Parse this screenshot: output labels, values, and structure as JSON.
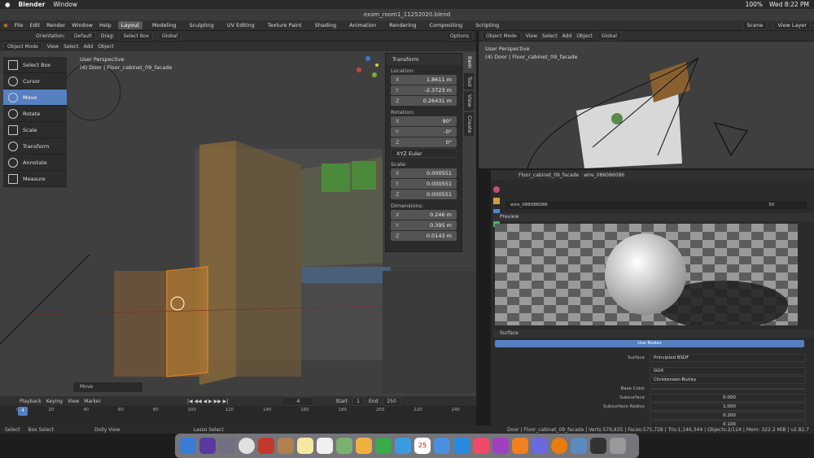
{
  "mac_menu": {
    "app": "Blender",
    "window": "Window",
    "battery": "100%",
    "clock": "Wed 8:22 PM"
  },
  "window_title": "exam_room1_11252020.blend",
  "top_menu": [
    "File",
    "Edit",
    "Render",
    "Window",
    "Help"
  ],
  "workspaces": [
    "Layout",
    "Modeling",
    "Sculpting",
    "UV Editing",
    "Texture Paint",
    "Shading",
    "Animation",
    "Rendering",
    "Compositing",
    "Scripting"
  ],
  "scene": "Scene",
  "view_layer": "View Layer",
  "vp_header": {
    "orientation_label": "Orientation:",
    "orientation": "Default",
    "drag_label": "Drag:",
    "drag": "Select Box",
    "global": "Global",
    "options": "Options"
  },
  "vp_header2": {
    "mode": "Object Mode",
    "view": "View",
    "select": "Select",
    "add": "Add",
    "object": "Object"
  },
  "vp_info": {
    "persp": "User Perspective",
    "obj": "(4) Door | Floor_cabinet_09_facade"
  },
  "tools": [
    "Select Box",
    "Cursor",
    "Move",
    "Rotate",
    "Scale",
    "Transform",
    "Annotate",
    "Measure"
  ],
  "transform": {
    "title": "Transform",
    "location_label": "Location:",
    "loc": [
      [
        "X",
        "1.8611 m"
      ],
      [
        "Y",
        "-2.3723 m"
      ],
      [
        "Z",
        "0.26431 m"
      ]
    ],
    "rotation_label": "Rotation:",
    "rot": [
      [
        "X",
        "90°"
      ],
      [
        "Y",
        "-0°"
      ],
      [
        "Z",
        "0°"
      ]
    ],
    "euler": "XYZ Euler",
    "scale_label": "Scale:",
    "scale": [
      [
        "X",
        "0.000551"
      ],
      [
        "Y",
        "0.000551"
      ],
      [
        "Z",
        "0.000551"
      ]
    ],
    "dim_label": "Dimensions:",
    "dim": [
      [
        "X",
        "0.246 m"
      ],
      [
        "Y",
        "0.395 m"
      ],
      [
        "Z",
        "0.0143 m"
      ]
    ]
  },
  "side_tabs": [
    "Item",
    "Tool",
    "View",
    "Create"
  ],
  "move_op": "Move",
  "right_vp": {
    "mode": "Object Mode",
    "view": "View",
    "select": "Select",
    "add": "Add",
    "object": "Object",
    "global": "Global",
    "persp": "User Perspective",
    "obj": "(4) Door | Floor_cabinet_09_facade"
  },
  "props": {
    "object": "Floor_cabinet_09_facade",
    "material": "wire_086086086",
    "mat_slot": "wire_086086086",
    "users": "30",
    "preview": "Preview",
    "surface": "Surface",
    "use_nodes": "Use Nodes",
    "rows": [
      [
        "Surface",
        "Principled BSDF"
      ],
      [
        "",
        "GGX"
      ],
      [
        "",
        "Christensen-Burley"
      ],
      [
        "Base Color",
        ""
      ],
      [
        "Subsurface",
        "0.000"
      ],
      [
        "Subsurface Radius",
        "1.000"
      ],
      [
        "",
        "0.200"
      ],
      [
        "",
        "0.100"
      ]
    ]
  },
  "timeline": {
    "playback": "Playback",
    "keying": "Keying",
    "view": "View",
    "marker": "Marker",
    "frame": "4",
    "start_label": "Start",
    "start": "1",
    "end_label": "End",
    "end": "250",
    "ticks": [
      "0",
      "20",
      "40",
      "60",
      "80",
      "100",
      "120",
      "140",
      "160",
      "180",
      "200",
      "220",
      "240"
    ]
  },
  "status": {
    "select": "Select",
    "box": "Box Select",
    "dolly": "Dolly View",
    "lasso": "Lasso Select",
    "info": "Door | Floor_cabinet_09_facade | Verts:576,835 | Faces:575,728 | Tris:1,146,344 | Objects:2/124 | Mem: 322.2 MiB | v2.82.7"
  },
  "dock": {
    "calendar_day": "25"
  }
}
